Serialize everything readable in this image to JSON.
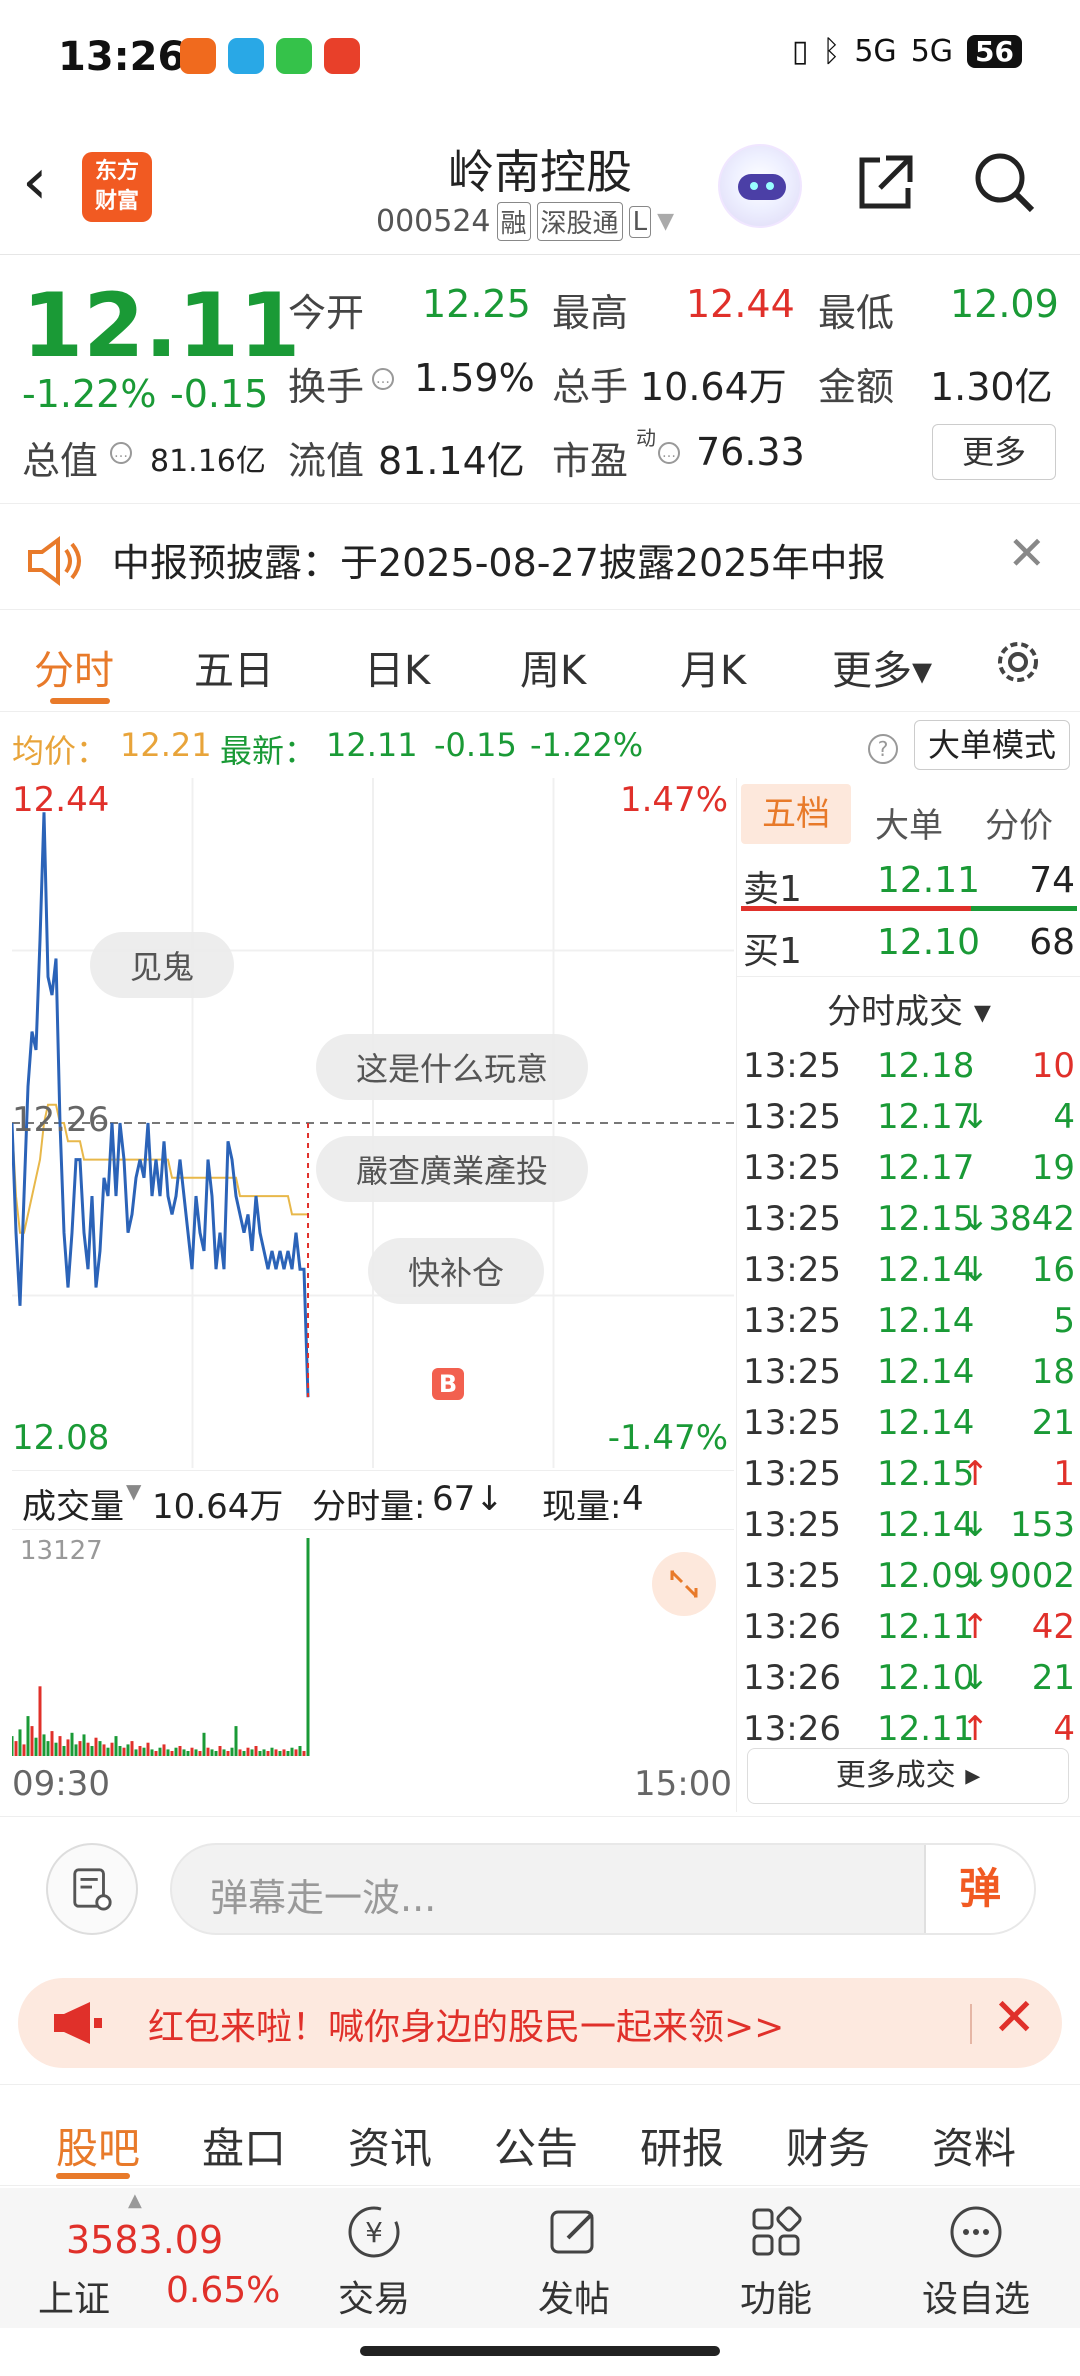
{
  "status_bar": {
    "time": "13:26",
    "battery": "56",
    "network": "5G"
  },
  "header": {
    "stock_name": "岭南控股",
    "stock_code": "000524",
    "tags": [
      "融",
      "深股通",
      "L"
    ],
    "logo_text_1": "东方",
    "logo_text_2": "财富"
  },
  "quote": {
    "price": "12.11",
    "change_pct": "-1.22%",
    "change_amt": "-0.15",
    "open_label": "今开",
    "open": "12.25",
    "high_label": "最高",
    "high": "12.44",
    "low_label": "最低",
    "low": "12.09",
    "turnover_label": "换手",
    "turnover": "1.59%",
    "volume_label": "总手",
    "volume": "10.64万",
    "amount_label": "金额",
    "amount": "1.30亿",
    "mktcap_label": "总值",
    "mktcap": "81.16亿",
    "float_label": "流值",
    "float_cap": "81.14亿",
    "pe_label": "市盈",
    "pe_sup": "动",
    "pe": "76.33",
    "more_button": "更多"
  },
  "notice": {
    "text": "中报预披露：于2025-08-27披露2025年中报"
  },
  "chart_tabs": {
    "items": [
      "分时",
      "五日",
      "日K",
      "周K",
      "月K",
      "更多▾"
    ],
    "active": 0
  },
  "info_line": {
    "avg_label": "均价：",
    "avg": "12.21",
    "latest_label": "最新：",
    "latest": "12.11",
    "change": "-0.15",
    "pct": "-1.22%",
    "mode_button": "大单模式"
  },
  "chart_labels": {
    "top_price": "12.44",
    "top_pct": "1.47%",
    "mid_price": "12.26",
    "bottom_price": "12.08",
    "bottom_pct": "-1.47%",
    "marker": "B"
  },
  "danmaku_bubbles": [
    "见鬼",
    "这是什么玩意",
    "嚴查廣業產投",
    "快补仓"
  ],
  "volume_bar": {
    "label": "成交量",
    "total": "10.64万",
    "minute_label": "分时量:",
    "minute_value": "67↓",
    "current_label": "现量:",
    "current_value": "4",
    "max_label": "13127"
  },
  "time_axis": {
    "start": "09:30",
    "end": "15:00"
  },
  "chart_data": {
    "type": "line",
    "title": "",
    "ylim": [
      12.08,
      12.44
    ],
    "prev_close": 12.26,
    "series": [
      {
        "name": "",
        "values": [
          12.26,
          12.2,
          12.16,
          12.22,
          12.28,
          12.31,
          12.3,
          12.36,
          12.43,
          12.34,
          12.33,
          12.35,
          12.26,
          12.2,
          12.17,
          12.2,
          12.24,
          12.24,
          12.2,
          12.18,
          12.22,
          12.17,
          12.19,
          12.23,
          12.22,
          12.26,
          12.22,
          12.26,
          12.24,
          12.2,
          12.21,
          12.23,
          12.24,
          12.23,
          12.26,
          12.22,
          12.24,
          12.22,
          12.25,
          12.22,
          12.21,
          12.22,
          12.24,
          12.22,
          12.2,
          12.18,
          12.22,
          12.2,
          12.19,
          12.24,
          12.22,
          12.18,
          12.2,
          12.18,
          12.25,
          12.24,
          12.22,
          12.21,
          12.2,
          12.21,
          12.19,
          12.22,
          12.2,
          12.19,
          12.18,
          12.19,
          12.18,
          12.19,
          12.18,
          12.19,
          12.18,
          12.2,
          12.18,
          12.18,
          12.11
        ]
      },
      {
        "name": "",
        "values": [
          12.26,
          12.22,
          12.2,
          12.2,
          12.21,
          12.22,
          12.23,
          12.24,
          12.26,
          12.27,
          12.27,
          12.27,
          12.26,
          12.26,
          12.25,
          12.25,
          12.25,
          12.25,
          12.24,
          12.24,
          12.24,
          12.24,
          12.24,
          12.24,
          12.24,
          12.24,
          12.24,
          12.24,
          12.24,
          12.24,
          12.24,
          12.24,
          12.24,
          12.24,
          12.24,
          12.24,
          12.24,
          12.24,
          12.24,
          12.24,
          12.23,
          12.23,
          12.23,
          12.23,
          12.23,
          12.23,
          12.23,
          12.23,
          12.23,
          12.23,
          12.23,
          12.23,
          12.23,
          12.23,
          12.23,
          12.23,
          12.23,
          12.22,
          12.22,
          12.22,
          12.22,
          12.22,
          12.22,
          12.22,
          12.22,
          12.22,
          12.22,
          12.22,
          12.22,
          12.22,
          12.21,
          12.21,
          12.21,
          12.21,
          12.21
        ]
      }
    ],
    "volume": [
      1200,
      900,
      1600,
      700,
      2400,
      1800,
      1100,
      4200,
      1300,
      900,
      1500,
      800,
      1200,
      600,
      1000,
      1400,
      700,
      900,
      1300,
      800,
      600,
      1100,
      900,
      700,
      500,
      800,
      1200,
      600,
      500,
      700,
      900,
      400,
      600,
      500,
      800,
      400,
      300,
      500,
      700,
      400,
      300,
      500,
      600,
      400,
      300,
      500,
      400,
      300,
      1400,
      500,
      400,
      300,
      600,
      400,
      300,
      500,
      1800,
      400,
      300,
      500,
      400,
      600,
      300,
      400,
      300,
      500,
      400,
      300,
      400,
      300,
      500,
      400,
      600,
      300,
      13127
    ],
    "volume_colors": [
      "g",
      "r",
      "g",
      "r",
      "g",
      "r",
      "g",
      "r",
      "g",
      "g",
      "r",
      "g",
      "r",
      "g",
      "r",
      "g",
      "g",
      "r",
      "g",
      "r",
      "g",
      "r",
      "g",
      "r",
      "g",
      "r",
      "g",
      "g",
      "r",
      "g",
      "r",
      "g",
      "r",
      "g",
      "r",
      "g",
      "r",
      "g",
      "r",
      "g",
      "r",
      "g",
      "r",
      "g",
      "g",
      "r",
      "g",
      "r",
      "g",
      "r",
      "g",
      "g",
      "r",
      "g",
      "r",
      "g",
      "g",
      "r",
      "g",
      "r",
      "g",
      "r",
      "g",
      "g",
      "r",
      "g",
      "r",
      "g",
      "r",
      "g",
      "g",
      "r",
      "g",
      "r",
      "g"
    ]
  },
  "right_panel": {
    "tabs": [
      "五档",
      "大单",
      "分价"
    ],
    "sell1": {
      "label": "卖1",
      "price": "12.11",
      "qty": "74"
    },
    "buy1": {
      "label": "买1",
      "price": "12.10",
      "qty": "68"
    },
    "trades_header": "分时成交 ▾",
    "trades": [
      {
        "time": "13:25",
        "price": "12.18",
        "arrow": "",
        "qty": "10",
        "qcolor": "red"
      },
      {
        "time": "13:25",
        "price": "12.17",
        "arrow": "↓",
        "qty": "4",
        "qcolor": "green"
      },
      {
        "time": "13:25",
        "price": "12.17",
        "arrow": "",
        "qty": "19",
        "qcolor": "green"
      },
      {
        "time": "13:25",
        "price": "12.15",
        "arrow": "↓",
        "qty": "3842",
        "qcolor": "green"
      },
      {
        "time": "13:25",
        "price": "12.14",
        "arrow": "↓",
        "qty": "16",
        "qcolor": "green"
      },
      {
        "time": "13:25",
        "price": "12.14",
        "arrow": "",
        "qty": "5",
        "qcolor": "green"
      },
      {
        "time": "13:25",
        "price": "12.14",
        "arrow": "",
        "qty": "18",
        "qcolor": "green"
      },
      {
        "time": "13:25",
        "price": "12.14",
        "arrow": "",
        "qty": "21",
        "qcolor": "green"
      },
      {
        "time": "13:25",
        "price": "12.15",
        "arrow": "↑",
        "qty": "1",
        "qcolor": "red"
      },
      {
        "time": "13:25",
        "price": "12.14",
        "arrow": "↓",
        "qty": "153",
        "qcolor": "green"
      },
      {
        "time": "13:25",
        "price": "12.09",
        "arrow": "↓",
        "qty": "9002",
        "qcolor": "green"
      },
      {
        "time": "13:26",
        "price": "12.11",
        "arrow": "↑",
        "qty": "42",
        "qcolor": "red"
      },
      {
        "time": "13:26",
        "price": "12.10",
        "arrow": "↓",
        "qty": "21",
        "qcolor": "green"
      },
      {
        "time": "13:26",
        "price": "12.11",
        "arrow": "↑",
        "qty": "4",
        "qcolor": "red"
      }
    ],
    "more_trades": "更多成交 ▸"
  },
  "danmaku": {
    "placeholder": "弹幕走一波...",
    "send_label": "弹"
  },
  "banner": {
    "text": "红包来啦！喊你身边的股民一起来领>>"
  },
  "sub_tabs": {
    "items": [
      "股吧",
      "盘口",
      "资讯",
      "公告",
      "研报",
      "财务",
      "资料"
    ],
    "active": 0
  },
  "bottom_nav": {
    "index_value": "3583.09",
    "index_name": "上证",
    "index_pct": "0.65%",
    "items": [
      "交易",
      "发帖",
      "功能",
      "设自选"
    ]
  },
  "colors": {
    "up": "#e0302a",
    "down": "#1a9a36",
    "accent": "#e87a2a",
    "price_line": "#2b63b8",
    "avg_line": "#e8b84a"
  }
}
